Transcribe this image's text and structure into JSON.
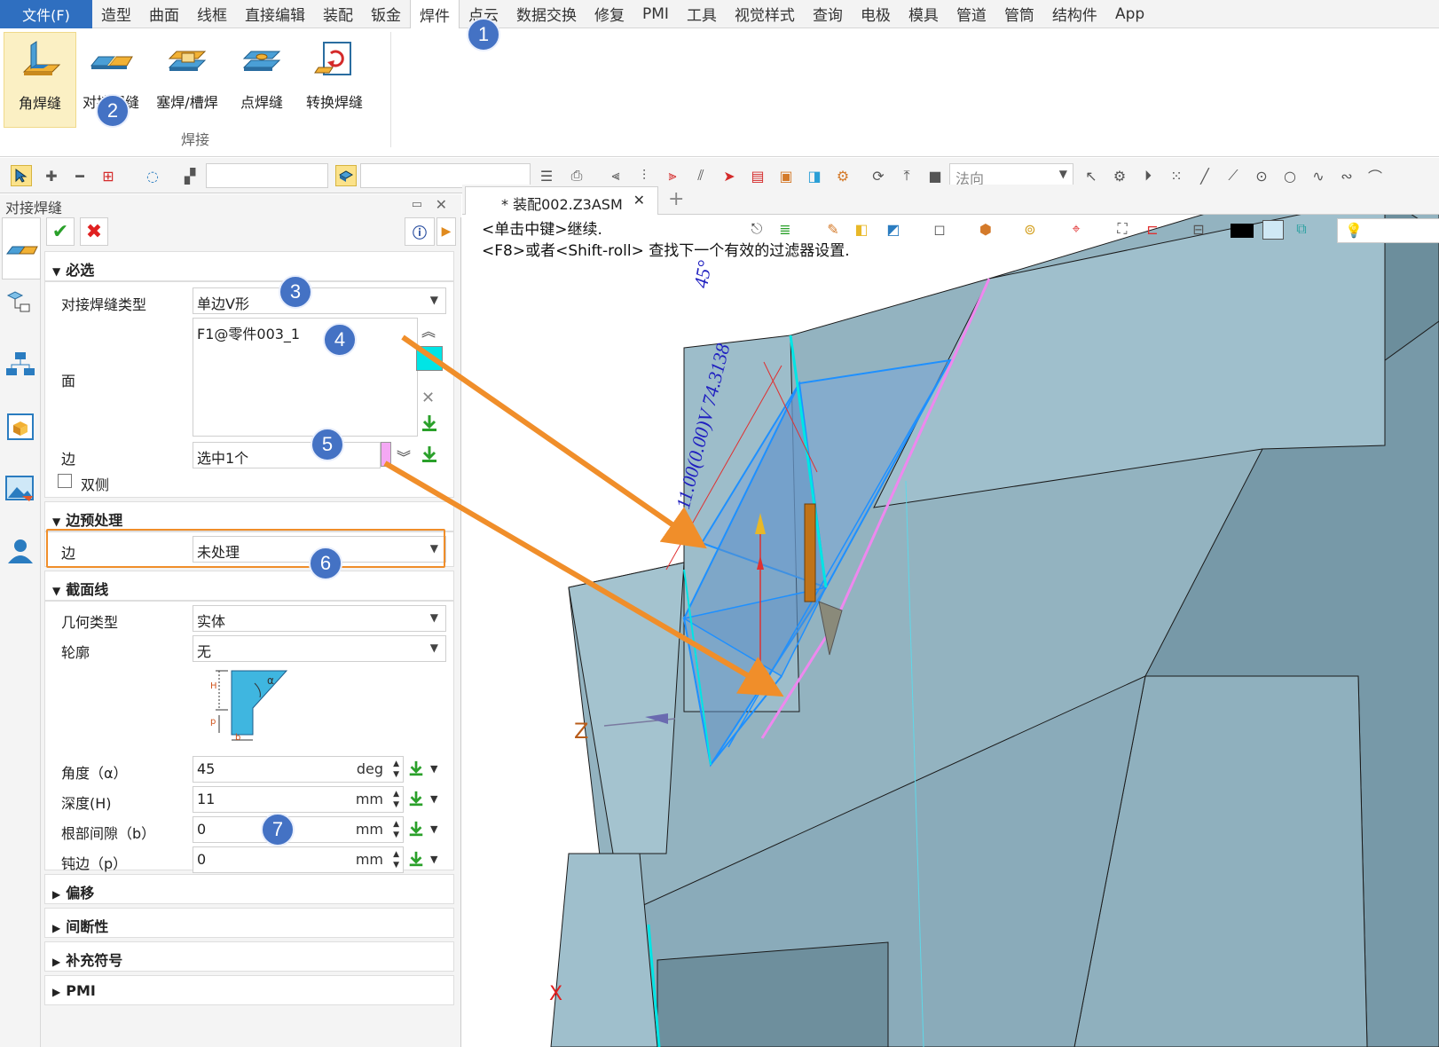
{
  "menu": {
    "file": "文件(F)",
    "items": [
      "造型",
      "曲面",
      "线框",
      "直接编辑",
      "装配",
      "钣金",
      "焊件",
      "点云",
      "数据交换",
      "修复",
      "PMI",
      "工具",
      "视觉样式",
      "查询",
      "电极",
      "模具",
      "管道",
      "管筒",
      "结构件",
      "App"
    ],
    "active_index": 6
  },
  "ribbon": {
    "buttons": [
      {
        "label": "角焊缝",
        "icon": "fillet-weld-icon"
      },
      {
        "label": "对接焊缝",
        "icon": "butt-weld-icon"
      },
      {
        "label": "塞焊/槽焊",
        "icon": "plug-slot-weld-icon"
      },
      {
        "label": "点焊缝",
        "icon": "spot-weld-icon"
      },
      {
        "label": "转换焊缝",
        "icon": "convert-weld-icon"
      }
    ],
    "group_label": "焊接"
  },
  "toolbar": {
    "filter_combo": "",
    "name_combo": "",
    "direction_combo": "法向"
  },
  "panel": {
    "title": "对接焊缝",
    "sections": {
      "required": "必选",
      "edge_prep": "边预处理",
      "profile": "截面线",
      "offset": "偏移",
      "intermittent": "间断性",
      "symbol": "补充符号",
      "pmi": "PMI"
    },
    "butt_type_label": "对接焊缝类型",
    "butt_type_value": "单边V形",
    "face_label": "面",
    "face_value": "F1@零件003_1",
    "edge_label": "边",
    "edge_value": "选中1个",
    "both_sides_label": "双侧",
    "edge_prep_label": "边",
    "edge_prep_value": "未处理",
    "geom_type_label": "几何类型",
    "geom_type_value": "实体",
    "contour_label": "轮廓",
    "contour_value": "无",
    "diagram_labels": {
      "h": "H",
      "alpha": "α",
      "p": "p",
      "b": "b"
    },
    "params": [
      {
        "label": "角度（α）",
        "value": "45",
        "unit": "deg"
      },
      {
        "label": "深度(H)",
        "value": "11",
        "unit": "mm"
      },
      {
        "label": "根部间隙（b）",
        "value": "0",
        "unit": "mm"
      },
      {
        "label": "钝边（p）",
        "value": "0",
        "unit": "mm"
      }
    ]
  },
  "doc": {
    "tab": "* 装配002.Z3ASM",
    "close": "✕",
    "add": "+"
  },
  "viewport": {
    "msg1": "<单击中键>继续.",
    "msg2": "<F8>或者<Shift-roll> 查找下一个有效的过滤器设置.",
    "dim_angle": "45°",
    "dim_weld": "11.00(0.00)V 74.3138",
    "axis_z": "Z",
    "axis_x": "X"
  },
  "callouts": [
    "1",
    "2",
    "3",
    "4",
    "5",
    "6",
    "7"
  ],
  "colors": {
    "accent": "#2f6fc0",
    "badge": "#4472c4",
    "arrow": "#f08e2a",
    "model": "#93b3c0",
    "cyan": "#00e5e5",
    "magenta": "#ee88ee"
  }
}
